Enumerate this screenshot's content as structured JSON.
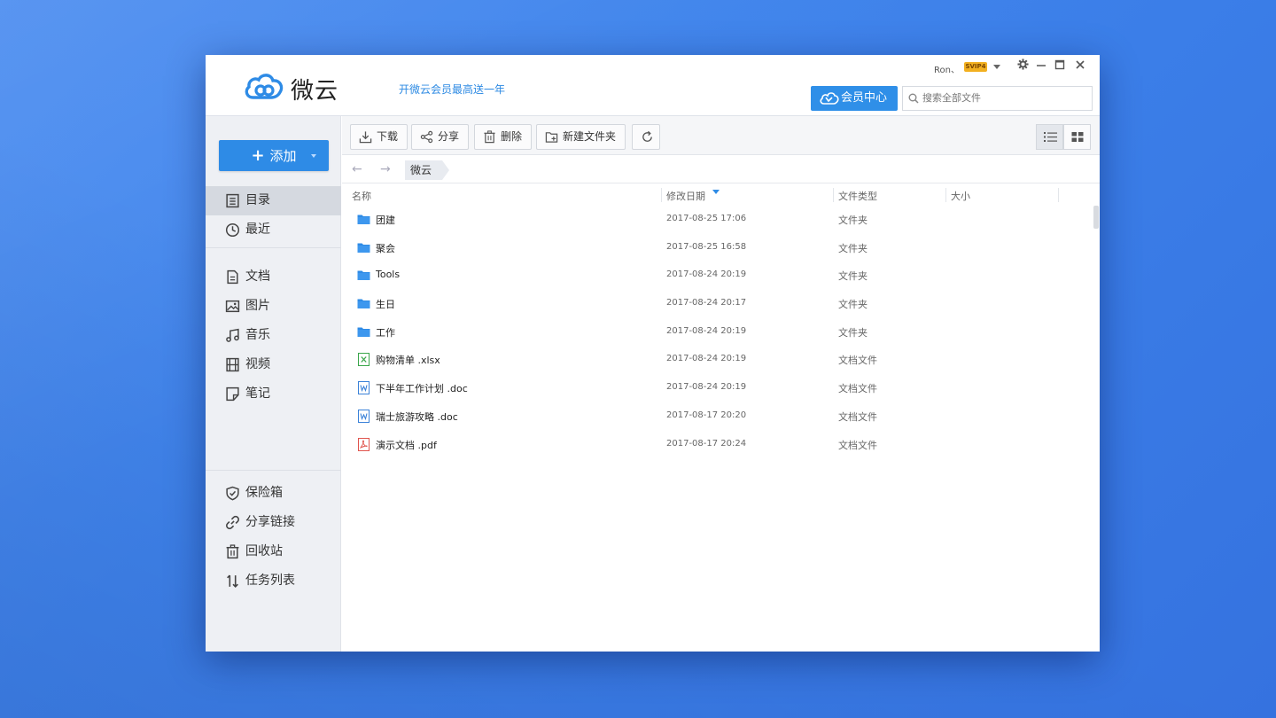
{
  "header": {
    "logo_text": "微云",
    "promo": "开微云会员最高送一年",
    "user": "Ron、",
    "badge": "SVIP4",
    "vip_center": "会员中心",
    "search_placeholder": "搜索全部文件"
  },
  "sidebar": {
    "add_label": "添加",
    "groups": [
      [
        {
          "label": "目录",
          "icon": "catalog-icon",
          "active": true
        },
        {
          "label": "最近",
          "icon": "clock-icon"
        }
      ],
      [
        {
          "label": "文档",
          "icon": "document-icon"
        },
        {
          "label": "图片",
          "icon": "image-icon"
        },
        {
          "label": "音乐",
          "icon": "music-icon"
        },
        {
          "label": "视频",
          "icon": "video-icon"
        },
        {
          "label": "笔记",
          "icon": "note-icon"
        }
      ],
      [
        {
          "label": "保险箱",
          "icon": "shield-icon"
        },
        {
          "label": "分享链接",
          "icon": "link-icon"
        },
        {
          "label": "回收站",
          "icon": "trash-icon"
        },
        {
          "label": "任务列表",
          "icon": "transfer-icon"
        }
      ]
    ]
  },
  "toolbar": {
    "download": "下载",
    "share": "分享",
    "delete": "删除",
    "new_folder": "新建文件夹"
  },
  "breadcrumb": {
    "current": "微云"
  },
  "table": {
    "columns": {
      "name": "名称",
      "date": "修改日期",
      "type": "文件类型",
      "size": "大小"
    },
    "rows": [
      {
        "name": "团建",
        "date": "2017-08-25 17:06",
        "type": "文件夹",
        "kind": "folder"
      },
      {
        "name": "聚会",
        "date": "2017-08-25 16:58",
        "type": "文件夹",
        "kind": "folder"
      },
      {
        "name": "Tools",
        "date": "2017-08-24 20:19",
        "type": "文件夹",
        "kind": "folder"
      },
      {
        "name": "生日",
        "date": "2017-08-24 20:17",
        "type": "文件夹",
        "kind": "folder"
      },
      {
        "name": "工作",
        "date": "2017-08-24 20:19",
        "type": "文件夹",
        "kind": "folder"
      },
      {
        "name": "购物清单 .xlsx",
        "date": "2017-08-24 20:19",
        "type": "文档文件",
        "kind": "excel"
      },
      {
        "name": "下半年工作计划 .doc",
        "date": "2017-08-24 20:19",
        "type": "文档文件",
        "kind": "word"
      },
      {
        "name": "瑞士旅游攻略 .doc",
        "date": "2017-08-17 20:20",
        "type": "文档文件",
        "kind": "word"
      },
      {
        "name": "演示文档 .pdf",
        "date": "2017-08-17 20:24",
        "type": "文档文件",
        "kind": "pdf"
      }
    ]
  },
  "colors": {
    "accent": "#2e8be6",
    "folder": "#2e8be6",
    "excel": "#3aa64a",
    "word": "#3b82d8",
    "pdf": "#e0544d"
  }
}
